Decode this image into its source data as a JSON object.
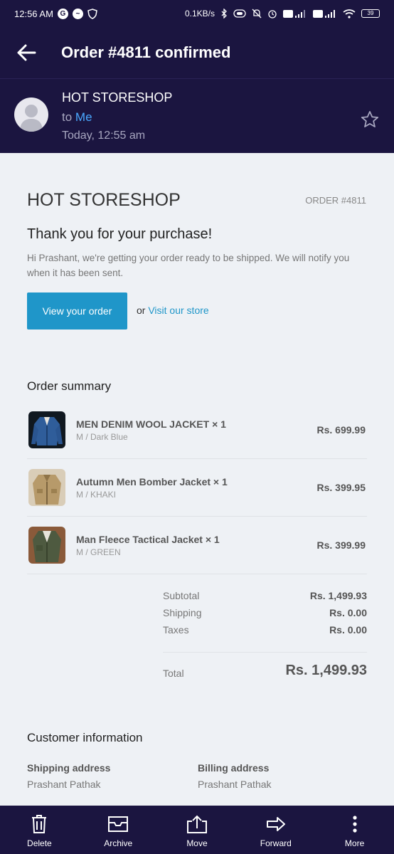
{
  "status": {
    "time": "12:56 AM",
    "speed": "0.1KB/s",
    "battery": "39"
  },
  "appbar": {
    "title": "Order #4811 confirmed"
  },
  "sender": {
    "name": "HOT STORESHOP",
    "to_prefix": "to",
    "to_name": "Me",
    "time": "Today, 12:55 am"
  },
  "email": {
    "shop_name": "HOT STORESHOP",
    "order_number": "ORDER #4811",
    "thanks_heading": "Thank you for your purchase!",
    "thanks_message": "Hi Prashant, we're getting your order ready to be shipped. We will notify you when it has been sent.",
    "view_order_button": "View your order",
    "or_text": "or",
    "visit_store_link": "Visit our store",
    "summary_title": "Order summary",
    "items": [
      {
        "name": "MEN DENIM WOOL JACKET × 1",
        "variant": "M / Dark Blue",
        "price": "Rs. 699.99"
      },
      {
        "name": "Autumn Men Bomber Jacket × 1",
        "variant": "M / KHAKI",
        "price": "Rs. 399.95"
      },
      {
        "name": "Man Fleece Tactical Jacket × 1",
        "variant": "M / GREEN",
        "price": "Rs. 399.99"
      }
    ],
    "totals": {
      "subtotal_label": "Subtotal",
      "subtotal": "Rs. 1,499.93",
      "shipping_label": "Shipping",
      "shipping": "Rs. 0.00",
      "taxes_label": "Taxes",
      "taxes": "Rs. 0.00",
      "total_label": "Total",
      "total": "Rs. 1,499.93"
    },
    "customer": {
      "title": "Customer information",
      "shipping_heading": "Shipping address",
      "shipping_name": "Prashant Pathak",
      "billing_heading": "Billing address",
      "billing_name": "Prashant Pathak"
    }
  },
  "bottom_bar": [
    {
      "label": "Delete",
      "icon": "trash-icon"
    },
    {
      "label": "Archive",
      "icon": "archive-icon"
    },
    {
      "label": "Move",
      "icon": "move-icon"
    },
    {
      "label": "Forward",
      "icon": "forward-icon"
    },
    {
      "label": "More",
      "icon": "more-icon"
    }
  ],
  "colors": {
    "header_bg": "#1b1540",
    "accent": "#1f96c9",
    "link_me": "#4aa8ff",
    "page_bg": "#eef1f5"
  }
}
